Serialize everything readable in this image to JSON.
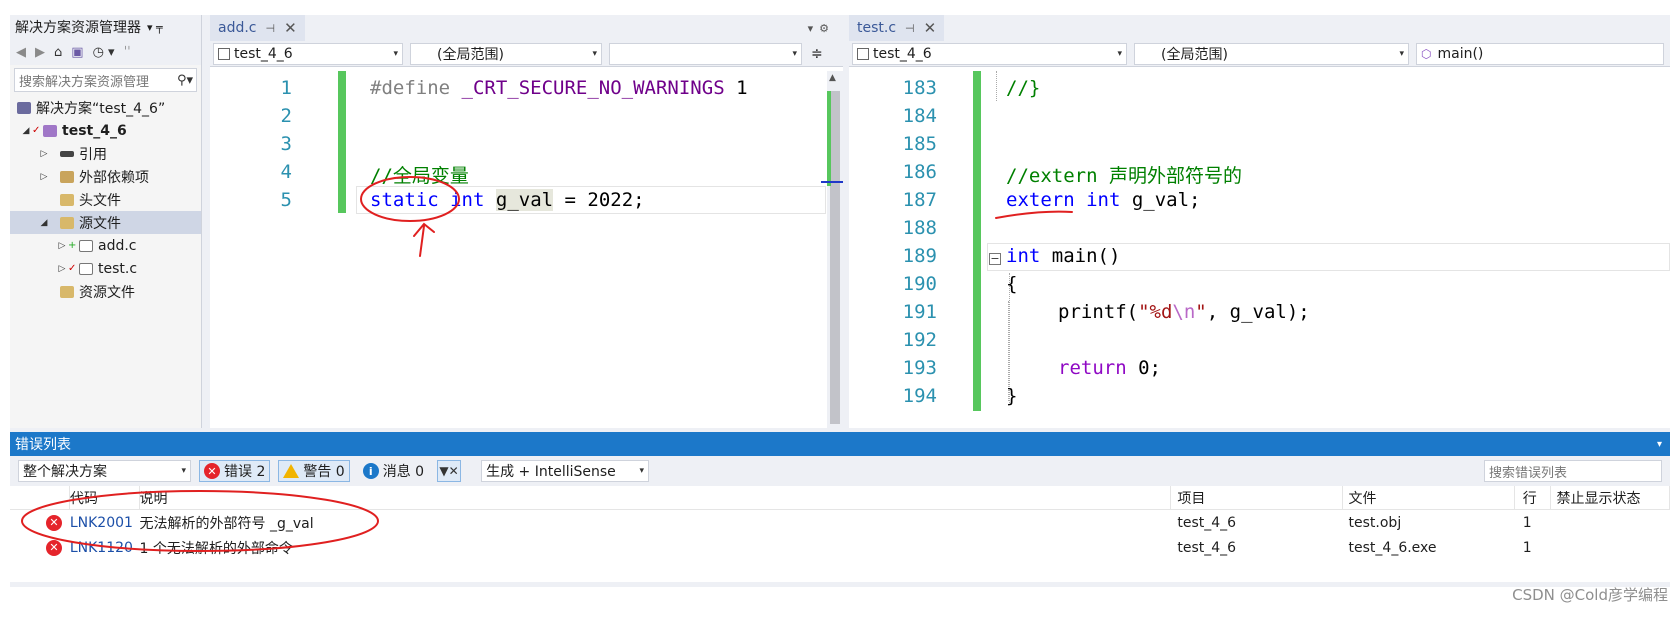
{
  "solution_explorer": {
    "title": "解决方案资源管理器",
    "title_controls": "▾ ╤",
    "search_placeholder": "搜索解决方案资源管理",
    "tree": {
      "solution": "解决方案“test_4_6”",
      "project": "test_4_6",
      "references": "引用",
      "external_deps": "外部依赖项",
      "header_files": "头文件",
      "source_files": "源文件",
      "file_add": "add.c",
      "file_test": "test.c",
      "resource_files": "资源文件"
    }
  },
  "left_editor": {
    "tab": "add.c",
    "nav": {
      "project": "test_4_6",
      "scope": "(全局范围)",
      "member": ""
    },
    "line_numbers": [
      "1",
      "2",
      "3",
      "4",
      "5"
    ],
    "line1_directive": "#define",
    "line1_macro": "_CRT_SECURE_NO_WARNINGS",
    "line1_value": "1",
    "line4_comment": "//全局变量",
    "line5_static": "static",
    "line5_int": "int",
    "line5_gval": "g_val",
    "line5_rest": " = 2022;"
  },
  "right_editor": {
    "tab": "test.c",
    "nav": {
      "project": "test_4_6",
      "scope": "(全局范围)",
      "member": "main()"
    },
    "line_numbers": [
      "183",
      "184",
      "185",
      "186",
      "187",
      "188",
      "189",
      "190",
      "191",
      "192",
      "193",
      "194"
    ],
    "line183": "//}",
    "line186": "//extern 声明外部符号的",
    "line187_extern": "extern",
    "line187_int": "int",
    "line187_rest": " g_val;",
    "line189_int": "int",
    "line189_rest": " main()",
    "line190": "{",
    "line191_printf": "printf(",
    "line191_str1": "\"%d",
    "line191_esc": "\\n",
    "line191_str2": "\"",
    "line191_rest": ", g_val);",
    "line193_return": "return",
    "line193_rest": " 0;",
    "line194": "}"
  },
  "error_list": {
    "title": "错误列表",
    "scope": "整个解决方案",
    "errors_label": "错误 2",
    "warnings_label": "警告 0",
    "messages_label": "消息 0",
    "build_filter": "生成 + IntelliSense",
    "search_placeholder": "搜索错误列表",
    "columns": {
      "code": "代码",
      "description": "说明",
      "project": "项目",
      "file": "文件",
      "line": "行",
      "suppression": "禁止显示状态"
    },
    "rows": [
      {
        "code": "LNK2001",
        "description": "无法解析的外部符号 _g_val",
        "project": "test_4_6",
        "file": "test.obj",
        "line": "1"
      },
      {
        "code": "LNK1120",
        "description": "1 个无法解析的外部命令",
        "project": "test_4_6",
        "file": "test_4_6.exe",
        "line": "1"
      }
    ]
  },
  "watermark": "CSDN @Cold彦学编程",
  "colors": {
    "accent": "#1c78c9",
    "keyword": "#0000ff",
    "comment": "#008000",
    "macro": "#6f008a",
    "annotation_red": "#e02020"
  }
}
